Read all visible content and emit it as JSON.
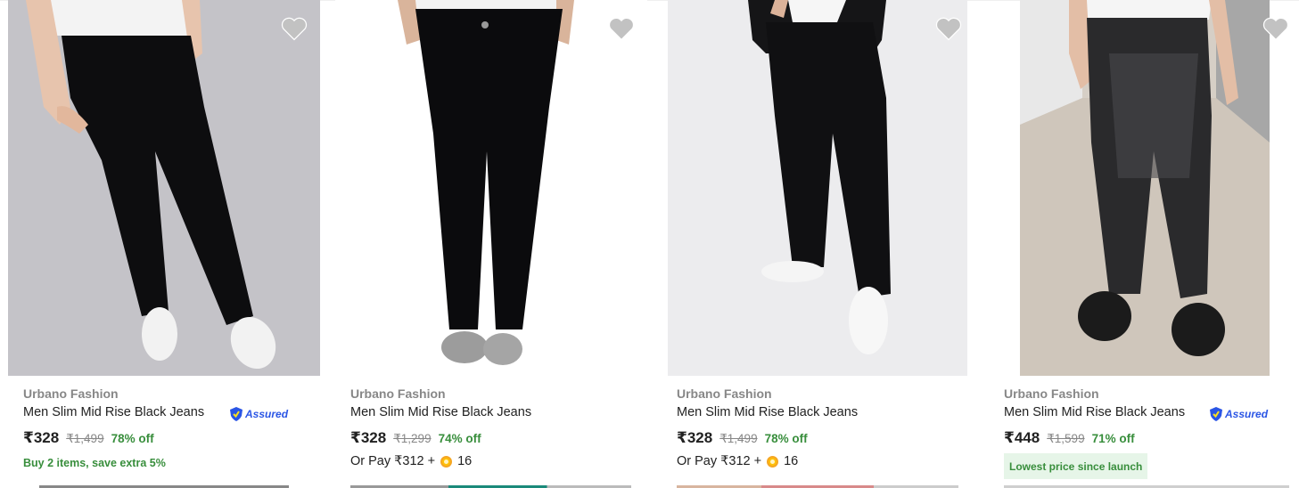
{
  "products": [
    {
      "brand": "Urbano Fashion",
      "title": "Men Slim Mid Rise Black Jeans",
      "assured": true,
      "assured_label": "Assured",
      "price": "₹328",
      "mrp": "₹1,499",
      "discount": "78% off",
      "offer": "Buy 2 items, save extra 5%"
    },
    {
      "brand": "Urbano Fashion",
      "title": "Men Slim Mid Rise Black Jeans",
      "assured": false,
      "price": "₹328",
      "mrp": "₹1,299",
      "discount": "74% off",
      "pay_text": "Or Pay ₹312 +",
      "coins": "16"
    },
    {
      "brand": "Urbano Fashion",
      "title": "Men Slim Mid Rise Black Jeans",
      "assured": false,
      "price": "₹328",
      "mrp": "₹1,499",
      "discount": "78% off",
      "pay_text": "Or Pay ₹312 +",
      "coins": "16"
    },
    {
      "brand": "Urbano Fashion",
      "title": "Men Slim Mid Rise Black Jeans",
      "assured": true,
      "assured_label": "Assured",
      "price": "₹448",
      "mrp": "₹1,599",
      "discount": "71% off",
      "badge": "Lowest price since launch"
    }
  ],
  "colors": {
    "price_green": "#388e3c",
    "assured_blue": "#2a55e5",
    "heart_grey": "#c2c2c2",
    "badge_bg": "#e6f5e8"
  }
}
